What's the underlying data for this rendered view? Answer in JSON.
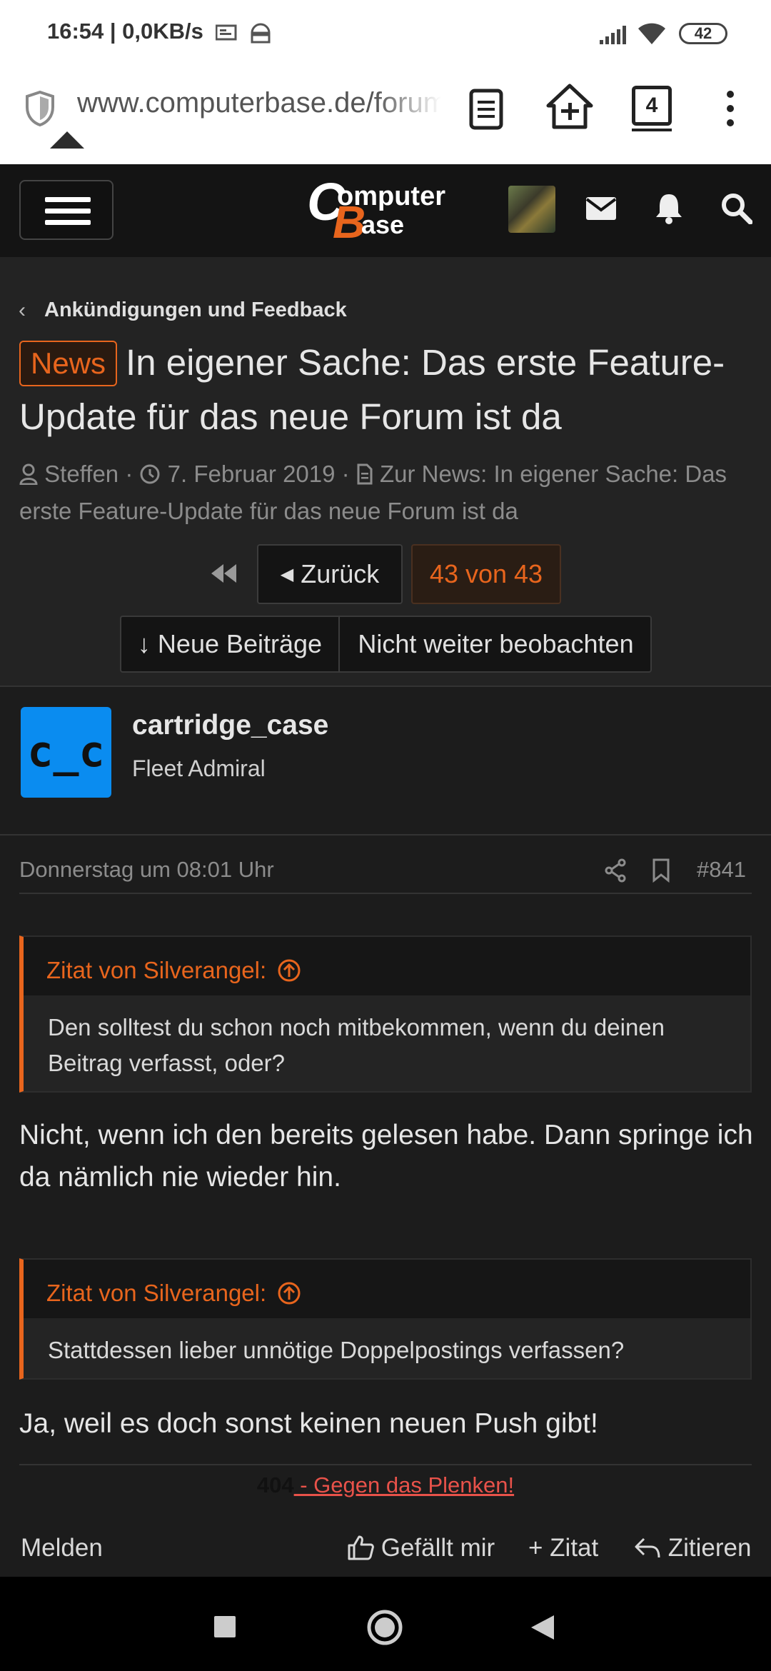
{
  "status_bar": {
    "time_speed": "16:54 | 0,0KB/s",
    "battery": "42"
  },
  "browser": {
    "url": "www.computerbase.de/forum/threads/in-eigener-sache",
    "tab_count": "4"
  },
  "site": {
    "logo_line1": "omputer",
    "logo_line2": "ase"
  },
  "thread": {
    "breadcrumb": "Ankündigungen und Feedback",
    "prefix": "News",
    "title": "In eigener Sache: Das erste Feature-Update für das neue Forum ist da",
    "author": "Steffen",
    "date": "7. Februar 2019",
    "news_link": "Zur News: In eigener Sache: Das erste Feature-Update für das neue Forum ist da"
  },
  "pager": {
    "back_label": "Zurück",
    "page_label": "43 von 43"
  },
  "thread_actions": {
    "new_posts": "↓ Neue Beiträge",
    "unwatch": "Nicht weiter beobachten"
  },
  "post": {
    "avatar_text": "c_c",
    "username": "cartridge_case",
    "user_title": "Fleet Admiral",
    "timestamp": "Donnerstag um 08:01 Uhr",
    "number": "#841",
    "quote1_head": "Zitat von Silverangel:",
    "quote1_body": "Den solltest du schon noch mitbekommen, wenn du deinen Beitrag verfasst, oder?",
    "reply1": "Nicht, wenn ich den bereits gelesen habe. Dann springe ich da nämlich nie wieder hin.",
    "quote2_head": "Zitat von Silverangel:",
    "quote2_body": "Stattdessen lieber unnötige Doppelpostings verfassen?",
    "reply2": "Ja, weil es doch sonst keinen neuen Push gibt!",
    "sig_code": "404",
    "sig_link": " - Gegen das Plenken!",
    "report": "Melden",
    "like": "Gefällt mir",
    "add_quote": "+ Zitat",
    "reply": "Zitieren"
  },
  "colors": {
    "accent": "#e8651d",
    "avatar_bg": "#0a8cf0",
    "link_red": "#e8524a"
  }
}
